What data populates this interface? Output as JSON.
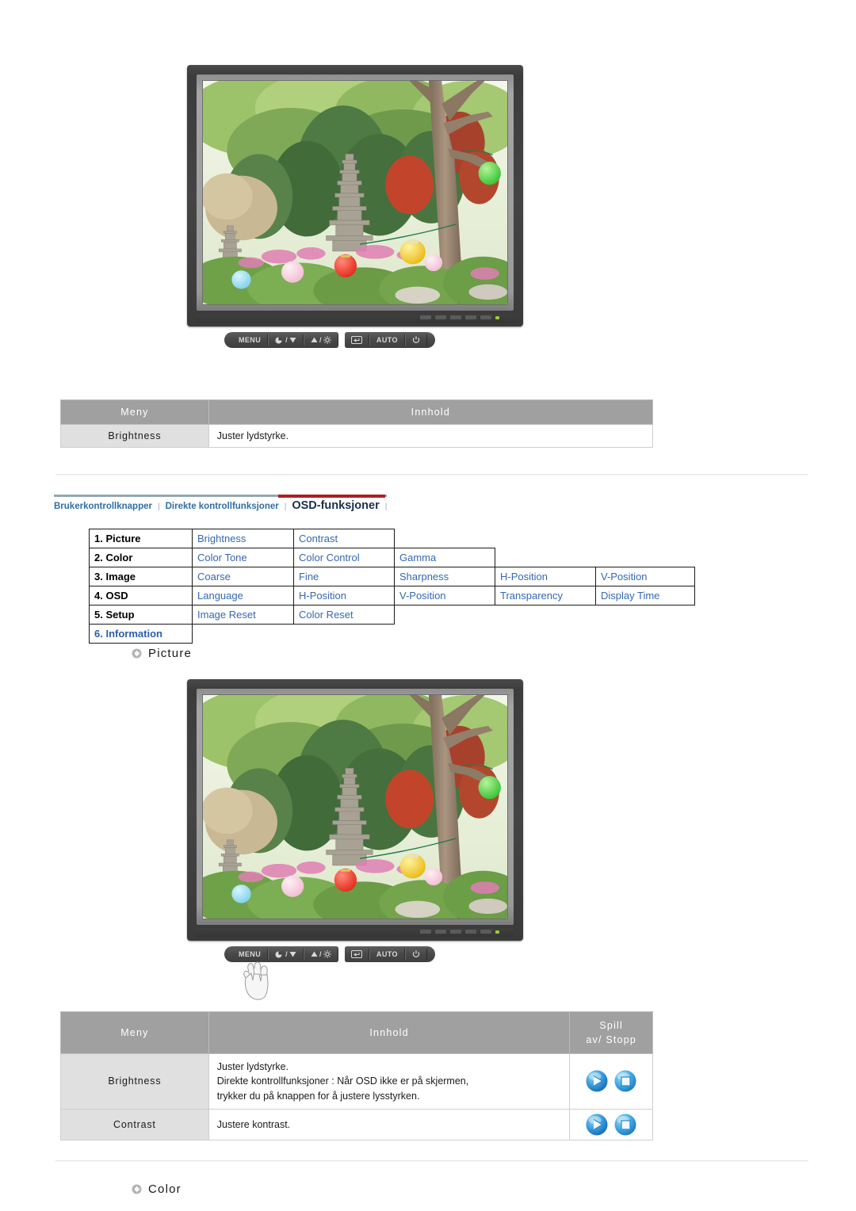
{
  "monitor": {
    "label": "lcd-monitor-with-garden-photo",
    "screen_image_desc": "Korean garden with stone pagoda, trees and colored paper lanterns",
    "buttons_left": [
      {
        "name": "menu-button",
        "label": "MENU",
        "icon": ""
      },
      {
        "name": "source-down-button",
        "label": "",
        "icon": "source-down"
      },
      {
        "name": "up-brightness-button",
        "label": "",
        "icon": "up-brightness"
      }
    ],
    "buttons_right": [
      {
        "name": "enter-button",
        "label": "",
        "icon": "enter"
      },
      {
        "name": "auto-button",
        "label": "AUTO",
        "icon": ""
      },
      {
        "name": "power-button",
        "label": "",
        "icon": "power"
      }
    ],
    "bezel_led": "power-led"
  },
  "table_brightness": {
    "headers": [
      "Meny",
      "Innhold"
    ],
    "rows": [
      {
        "menu": "Brightness",
        "content": [
          "Juster lydstyrke."
        ]
      }
    ]
  },
  "navbar": {
    "items": [
      {
        "label": "Brukerkontrollknapper",
        "active": false
      },
      {
        "label": "Direkte kontrollfunksjoner",
        "active": false
      },
      {
        "label": "OSD-funksjoner",
        "active": true
      }
    ],
    "separator": "|",
    "rule_color": "#94a8ad",
    "active_rule_color": "#ac1f28",
    "link_color": "#2f6ea5",
    "active_color": "#18304e"
  },
  "osd_matrix": {
    "rows": [
      {
        "category": "1. Picture",
        "highlight": false,
        "items": [
          "Brightness",
          "Contrast"
        ]
      },
      {
        "category": "2. Color",
        "highlight": false,
        "items": [
          "Color Tone",
          "Color Control",
          "Gamma"
        ]
      },
      {
        "category": "3. Image",
        "highlight": false,
        "items": [
          "Coarse",
          "Fine",
          "Sharpness",
          "H-Position",
          "V-Position"
        ]
      },
      {
        "category": "4. OSD",
        "highlight": false,
        "items": [
          "Language",
          "H-Position",
          "V-Position",
          "Transparency",
          "Display Time"
        ]
      },
      {
        "category": "5. Setup",
        "highlight": false,
        "items": [
          "Image Reset",
          "Color Reset"
        ]
      },
      {
        "category": "6. Information",
        "highlight": true,
        "items": []
      }
    ],
    "item_color": "#3568b0",
    "category_color": "#000000",
    "highlight_color": "#2d5fa8"
  },
  "headings": {
    "picture": "Picture",
    "color": "Color"
  },
  "table_functions": {
    "headers": [
      "Meny",
      "Innhold",
      "Spill\nav/ Stopp"
    ],
    "header_play": {
      "line1": "Spill",
      "line2": "av/ Stopp"
    },
    "rows": [
      {
        "menu": "Brightness",
        "content": [
          "Juster lydstyrke.",
          "Direkte kontrollfunksjoner : Når OSD ikke er på skjermen,",
          "trykker du på knappen for å justere lysstyrken."
        ],
        "play": "play-stop-buttons"
      },
      {
        "menu": "Contrast",
        "content": [
          "Justere kontrast."
        ],
        "play": "play-stop-buttons"
      }
    ],
    "play_icon_color": "#2e8fd6",
    "stop_icon_color": "#3aa0e0"
  }
}
